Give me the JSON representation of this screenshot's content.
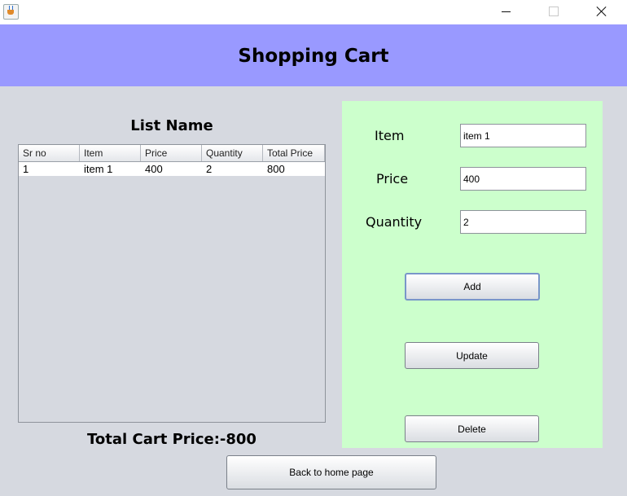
{
  "window": {
    "icon": "java-cup-icon",
    "controls": [
      "minimize-icon",
      "maximize-icon",
      "close-icon"
    ]
  },
  "header": {
    "title": "Shopping Cart",
    "bg_color": "#9999ff"
  },
  "list": {
    "title": "List Name",
    "columns": [
      "Sr no",
      "Item",
      "Price",
      "Quantity",
      "Total Price"
    ],
    "rows": [
      [
        "1",
        "item 1",
        "400",
        "2",
        "800"
      ]
    ]
  },
  "total_label": "Total Cart Price:-800",
  "form": {
    "bg_color": "#ccffcc",
    "item_label": "Item",
    "item_value": "item 1",
    "price_label": "Price",
    "price_value": "400",
    "quantity_label": "Quantity",
    "quantity_value": "2",
    "add_label": "Add",
    "update_label": "Update",
    "delete_label": "Delete"
  },
  "back_label": "Back to home page"
}
